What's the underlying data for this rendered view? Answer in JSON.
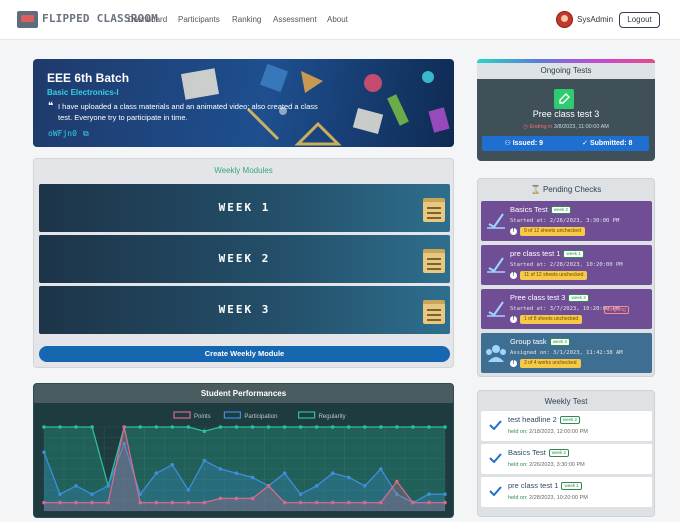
{
  "nav": {
    "brand": "FLIPPED CLASSROOM",
    "links": [
      "Dashboard",
      "Participants",
      "Ranking",
      "Assessment",
      "About"
    ],
    "username": "SysAdmin",
    "logout_label": "Logout"
  },
  "banner": {
    "title": "EEE 6th Batch",
    "course": "Basic Electronics-I",
    "message": "I have uploaded a class materials and an animated video; also created a class test. Everyone try to participate in time.",
    "code": "oWFjn0"
  },
  "modules": {
    "title": "Weekly Modules",
    "weeks": [
      "WEEK 1",
      "WEEK 2",
      "WEEK 3"
    ],
    "create_label": "Create Weekly Module"
  },
  "performance": {
    "title": "Student Performances",
    "chart_data": {
      "type": "area",
      "series": [
        {
          "name": "Points",
          "color": "#d46a8c",
          "values": [
            0.1,
            0.1,
            0.1,
            0.1,
            0.1,
            1.0,
            0.1,
            0.1,
            0.1,
            0.1,
            0.1,
            0.15,
            0.15,
            0.15,
            0.3,
            0.1,
            0.1,
            0.1,
            0.1,
            0.1,
            0.1,
            0.1,
            0.35,
            0.1,
            0.1,
            0.1
          ]
        },
        {
          "name": "Participation",
          "color": "#3c8fd8",
          "values": [
            0.7,
            0.2,
            0.3,
            0.2,
            0.3,
            0.8,
            0.2,
            0.45,
            0.55,
            0.25,
            0.6,
            0.5,
            0.45,
            0.4,
            0.3,
            0.45,
            0.2,
            0.3,
            0.45,
            0.4,
            0.3,
            0.5,
            0.2,
            0.1,
            0.2,
            0.2
          ]
        },
        {
          "name": "Regularity",
          "color": "#2bbf9f",
          "values": [
            1.0,
            1.0,
            1.0,
            1.0,
            0.3,
            1.0,
            1.0,
            1.0,
            1.0,
            1.0,
            0.95,
            1.0,
            1.0,
            1.0,
            1.0,
            1.0,
            1.0,
            1.0,
            1.0,
            1.0,
            1.0,
            1.0,
            1.0,
            1.0,
            1.0,
            1.0
          ]
        }
      ]
    }
  },
  "ongoing": {
    "title": "Ongoing Tests",
    "test_name": "Pree class test 3",
    "ending_label": "Ending in",
    "ending_value": "3/8/2023, 11:00:00 AM",
    "issued": "Issued: 9",
    "submitted": "Submitted: 8"
  },
  "pending": {
    "title": "Pending Checks",
    "items": [
      {
        "name": "Basics Test",
        "week": "week 2",
        "started": "Started at: 2/26/2023, 3:30:00 PM",
        "warning": "9 of 12 sheets unchecked",
        "ongoing": ""
      },
      {
        "name": "pre class test 1",
        "week": "week 1",
        "started": "Started at: 2/28/2023, 10:20:00 PM",
        "warning": "11 of 12 sheets unchecked",
        "ongoing": ""
      },
      {
        "name": "Pree class test 3",
        "week": "week 3",
        "started": "Started at: 3/7/2023, 10:20:00 PM",
        "warning": "1 of 8 sheets unchecked",
        "ongoing": "Ongoing"
      },
      {
        "name": "Group task",
        "week": "week 2",
        "started": "Assigned on: 3/1/2023, 11:42:38 AM",
        "warning": "3 of 4 works unchecked",
        "ongoing": ""
      }
    ]
  },
  "weekly_test": {
    "title": "Weekly Test",
    "items": [
      {
        "name": "test headline 2",
        "week": "week 2",
        "held_label": "held on:",
        "held": "2/18/2023, 12:00:00 PM"
      },
      {
        "name": "Basics Test",
        "week": "week 2",
        "held_label": "held on:",
        "held": "2/26/2023, 3:30:00 PM"
      },
      {
        "name": "pre class test 1",
        "week": "week 1",
        "held_label": "held on:",
        "held": "2/28/2023, 10:20:00 PM"
      }
    ]
  }
}
